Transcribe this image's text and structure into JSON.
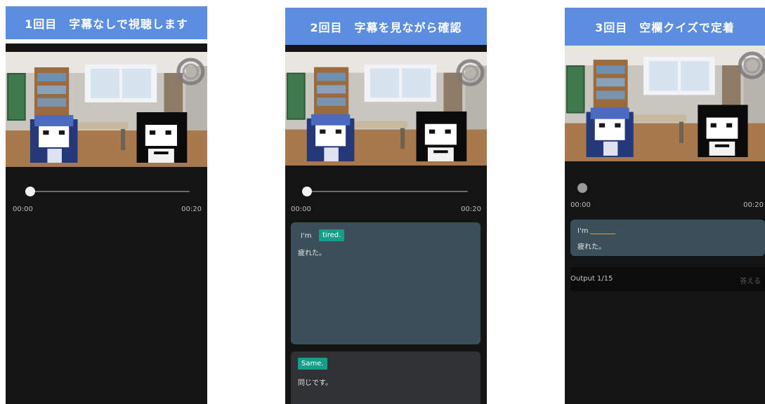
{
  "panels": [
    {
      "banner": "1回目　字幕なしで視聴します",
      "player": {
        "time_start": "00:00",
        "time_end": "00:20",
        "progress": 0
      }
    },
    {
      "banner": "2回目　字幕を見ながら確認",
      "player": {
        "time_start": "00:00",
        "time_end": "00:20",
        "progress": 0
      },
      "subtitles": [
        {
          "word": "I'm",
          "highlight": "tired.",
          "translation": "疲れた。"
        },
        {
          "highlight": "Same.",
          "translation": "同じです。"
        }
      ]
    },
    {
      "banner": "3回目　空欄クイズで定着",
      "player": {
        "time_start": "00:00",
        "time_end": "00:20",
        "progress": 0
      },
      "quiz": {
        "prompt": "I'm",
        "translation": "疲れた。"
      },
      "output": {
        "counter": "Output 1/15",
        "answer_button": "答える"
      }
    }
  ],
  "colors": {
    "banner": "#5b8ee0",
    "phone_bg": "#141414",
    "card_teal": "#3a4f5a",
    "card_dark": "#2f3133",
    "chip": "#13a08a",
    "blank": "#d4a93a"
  },
  "icons": [
    "record-circle-icon",
    "slider-thumb-icon"
  ]
}
